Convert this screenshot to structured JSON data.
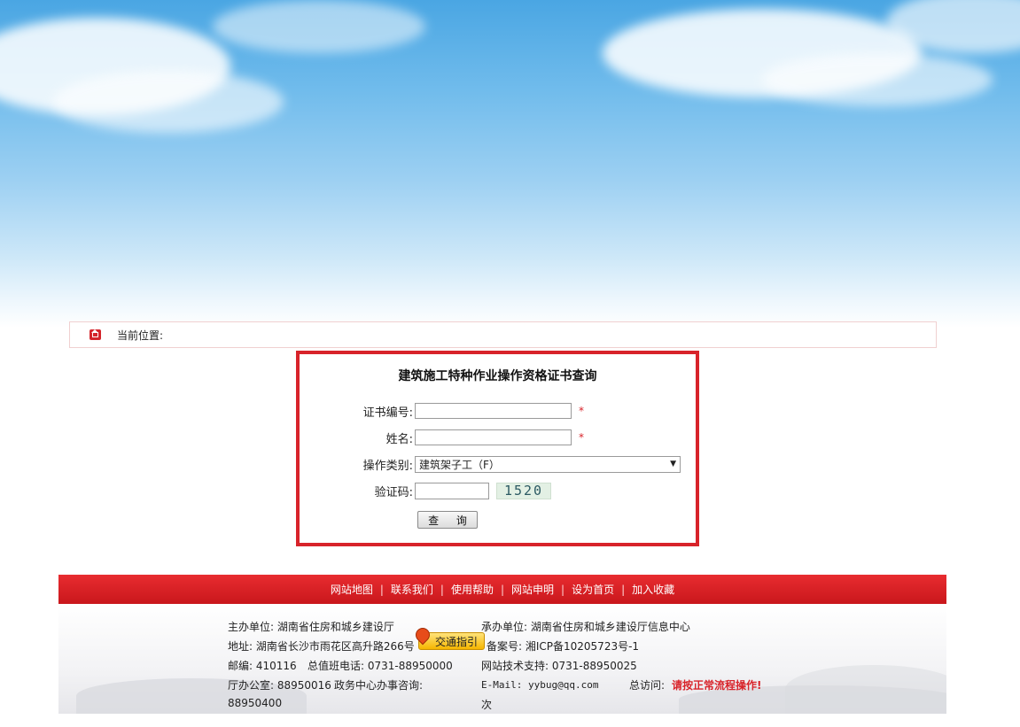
{
  "breadcrumb": {
    "label": "当前位置:"
  },
  "form": {
    "title": "建筑施工特种作业操作资格证书查询",
    "cert_no_label": "证书编号:",
    "cert_no_value": "",
    "name_label": "姓名:",
    "name_value": "",
    "required_mark": "*",
    "type_label": "操作类别:",
    "type_selected": "建筑架子工（F）",
    "dropdown_arrow": "▼",
    "captcha_label": "验证码:",
    "captcha_value": "",
    "captcha_image_text": "1520",
    "submit_label": "查 询"
  },
  "footer_nav": {
    "items": [
      "网站地图",
      "联系我们",
      "使用帮助",
      "网站申明",
      "设为首页",
      "加入收藏"
    ],
    "separator": "|"
  },
  "footer": {
    "sponsor": "主办单位: 湖南省住房和城乡建设厅",
    "organizer": "承办单位: 湖南省住房和城乡建设厅信息中心",
    "address": "地址: 湖南省长沙市雨花区高升路266号",
    "traffic_button": "交通指引",
    "icp": "备案号: 湘ICP备10205723号-1",
    "postcode": "邮编: 410116",
    "duty_phone": "总值班电话: 0731-88950000",
    "tech_support": "网站技术支持: 0731-88950025",
    "office": "厅办公室: 88950016",
    "service_consult": "政务中心办事咨询:",
    "service_phone": "88950400",
    "email": "E-Mail: yybug@qq.com",
    "visits_label": "总访问:",
    "visits_notice": "请按正常流程操作!",
    "visits_suffix": "次"
  }
}
